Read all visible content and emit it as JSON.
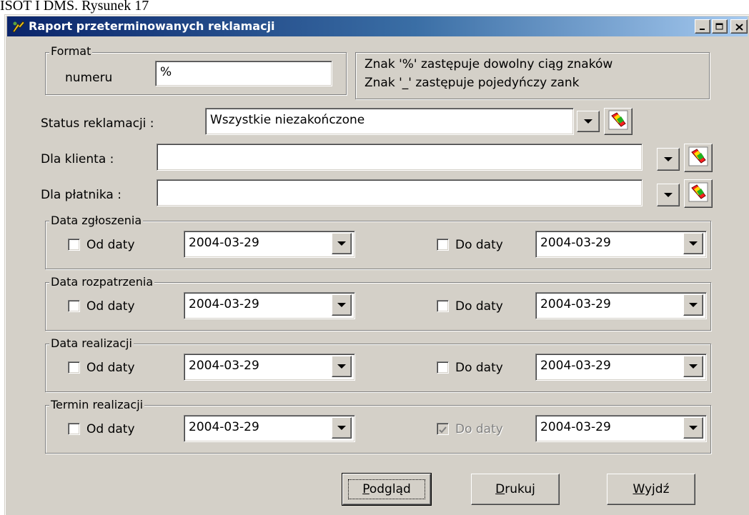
{
  "doc_caption": "ISOT I DMS. Rysunek 17",
  "window": {
    "title": "Raport przeterminowanych reklamacji",
    "colors": {
      "titlebar_start": "#0a246a",
      "titlebar_end": "#a6caf0",
      "face": "#d4d0c8"
    }
  },
  "format": {
    "group_label": "Format",
    "field_label": "numeru",
    "value": "%",
    "hint_line1": "Znak '%' zastępuje dowolny ciąg znaków",
    "hint_line2": "Znak '_' zastępuje pojedyńczy zank"
  },
  "status": {
    "label": "Status reklamacji :",
    "value": "Wszystkie niezakończone"
  },
  "klient": {
    "label": "Dla klienta :",
    "value": ""
  },
  "platnik": {
    "label": "Dla płatnika :",
    "value": ""
  },
  "date_groups": [
    {
      "title": "Data zgłoszenia",
      "from_label": "Od daty",
      "from_value": "2004-03-29",
      "from_checked": false,
      "to_label": "Do daty",
      "to_value": "2004-03-29",
      "to_checked": false,
      "to_disabled": false
    },
    {
      "title": "Data rozpatrzenia",
      "from_label": "Od daty",
      "from_value": "2004-03-29",
      "from_checked": false,
      "to_label": "Do daty",
      "to_value": "2004-03-29",
      "to_checked": false,
      "to_disabled": false
    },
    {
      "title": "Data realizacji",
      "from_label": "Od daty",
      "from_value": "2004-03-29",
      "from_checked": false,
      "to_label": "Do daty",
      "to_value": "2004-03-29",
      "to_checked": false,
      "to_disabled": false
    },
    {
      "title": "Termin realizacji",
      "from_label": "Od daty",
      "from_value": "2004-03-29",
      "from_checked": false,
      "to_label": "Do daty",
      "to_value": "2004-03-29",
      "to_checked": true,
      "to_disabled": true
    }
  ],
  "buttons": {
    "preview": "Podgląd",
    "print": "Drukuj",
    "exit": "Wyjdź"
  }
}
